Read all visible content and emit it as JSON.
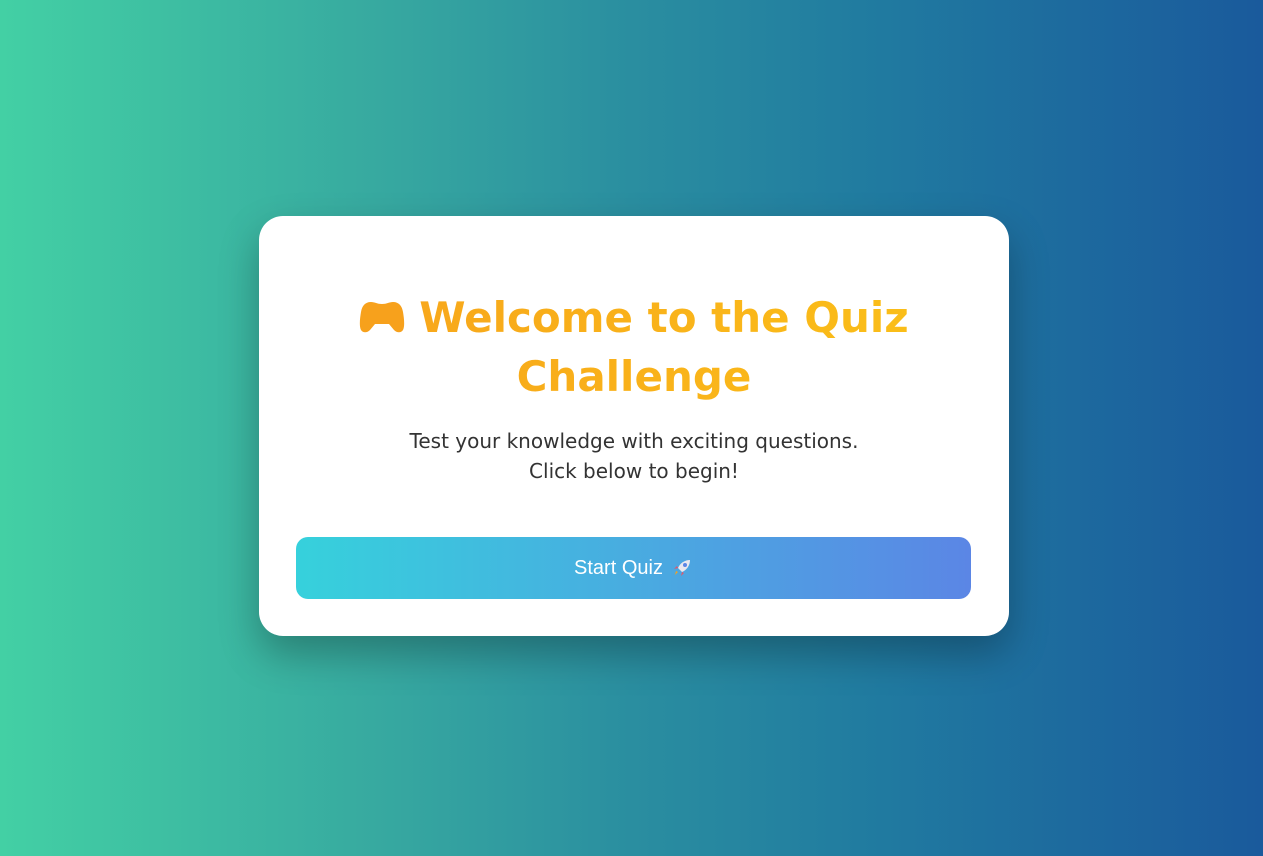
{
  "colors": {
    "title_gradient_start": "#f7a11c",
    "title_gradient_end": "#fbc218",
    "button_gradient_start": "#36d1dc",
    "button_gradient_end": "#5b86e5",
    "background_start": "#43d0a4",
    "background_end": "#1a5a9c"
  },
  "card": {
    "title_line_1": "Welcome to the Quiz",
    "title_line_2": "Challenge",
    "title_icon": "game-controller-icon",
    "subtitle_line_1": "Test your knowledge with exciting questions.",
    "subtitle_line_2": "Click below to begin!",
    "start_button_label": "Start Quiz",
    "start_button_icon": "rocket-icon"
  }
}
